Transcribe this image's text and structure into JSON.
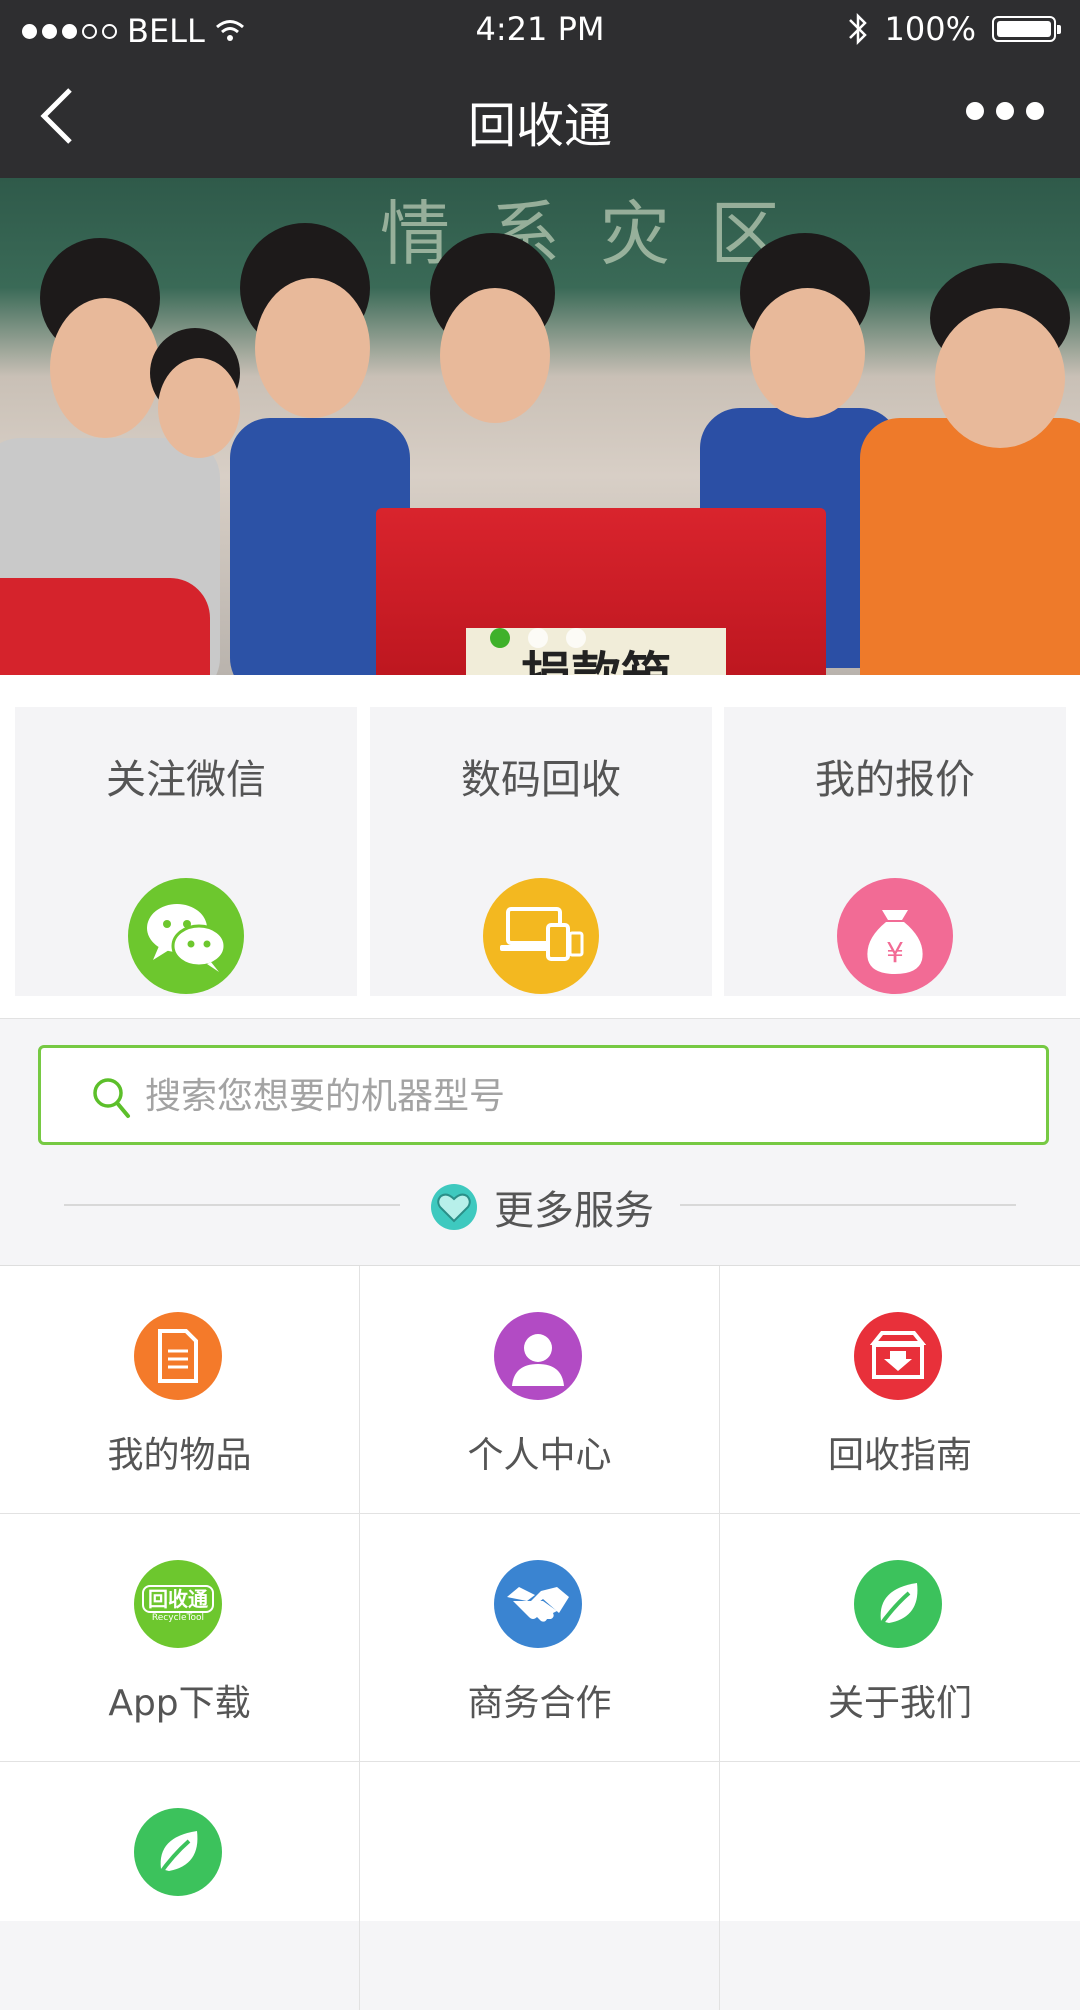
{
  "status_bar": {
    "carrier": "BELL",
    "time": "4:21 PM",
    "battery": "100%",
    "signal_icon": "signal-dots-icon",
    "wifi_icon": "wifi-icon",
    "bluetooth_icon": "bluetooth-icon"
  },
  "nav": {
    "title": "回收通",
    "back_icon": "chevron-left-icon",
    "more_icon": "more-dots-icon"
  },
  "banner": {
    "box_text": "捐款箱",
    "board_text": "情系灾区",
    "slides": 3,
    "active_slide": 1
  },
  "quick_tiles": [
    {
      "label": "关注微信",
      "icon": "wechat-icon",
      "color": "#6dc72e"
    },
    {
      "label": "数码回收",
      "icon": "devices-icon",
      "color": "#f3b820"
    },
    {
      "label": "我的报价",
      "icon": "money-bag-icon",
      "color": "#f26b95"
    }
  ],
  "search": {
    "placeholder": "搜索您想要的机器型号",
    "value": ""
  },
  "section": {
    "title": "更多服务",
    "icon": "heart-icon",
    "icon_color": "#3ec9bf"
  },
  "services": [
    {
      "label": "我的物品",
      "icon": "document-icon",
      "color": "#f47a2a"
    },
    {
      "label": "个人中心",
      "icon": "user-icon",
      "color": "#b24bc4"
    },
    {
      "label": "回收指南",
      "icon": "download-box-icon",
      "color": "#e8303a"
    },
    {
      "label": "App下载",
      "icon": "app-logo-icon",
      "color": "#6dc72e",
      "logo_text": "回收通",
      "logo_subtext": "RecycleTool"
    },
    {
      "label": "商务合作",
      "icon": "handshake-icon",
      "color": "#3a84d1"
    },
    {
      "label": "关于我们",
      "icon": "leaf-icon",
      "color": "#3cc25c"
    },
    {
      "label": "",
      "icon": "leaf-icon",
      "color": "#3cc25c"
    }
  ],
  "colors": {
    "header_bg": "#2e2e30",
    "accent_green": "#76c943",
    "page_bg": "#f5f5f7"
  }
}
